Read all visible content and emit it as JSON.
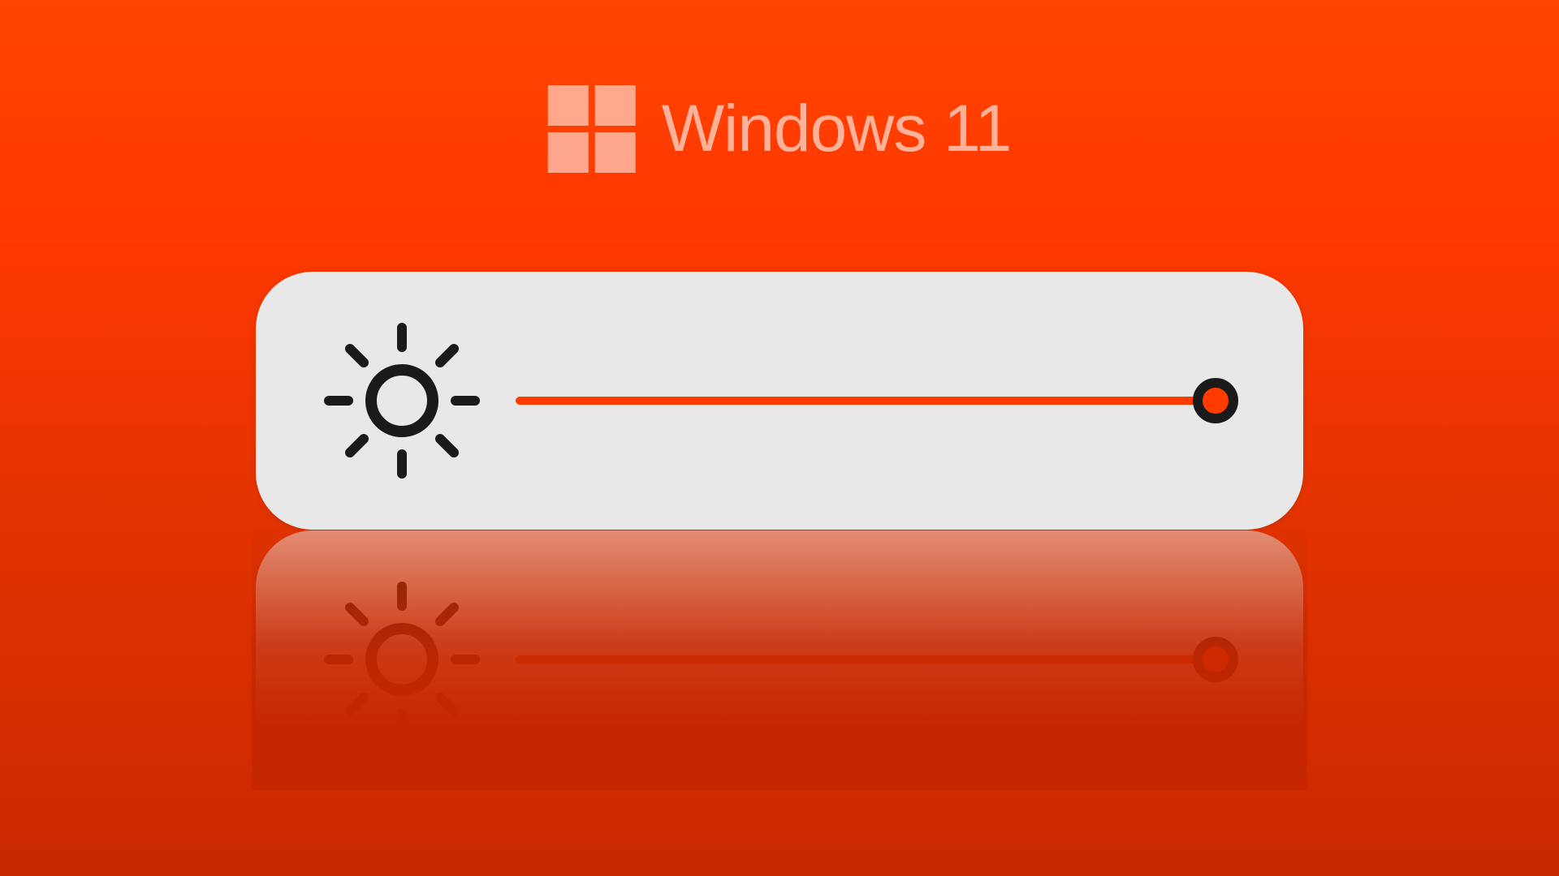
{
  "header": {
    "title": "Windows 11"
  },
  "slider": {
    "value_percent": 100,
    "accent_color": "#ff3b00",
    "thumb_border_color": "#1a1a1a",
    "panel_color": "#e8e8e8"
  }
}
